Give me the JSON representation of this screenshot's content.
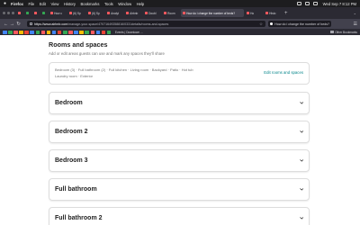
{
  "menubar": {
    "app": "Firefox",
    "items": [
      "File",
      "Edit",
      "View",
      "History",
      "Bookmarks",
      "Tools",
      "Window",
      "Help"
    ],
    "clock": "Wed Sep 7  8:12 PM"
  },
  "tabs": [
    {
      "label": "",
      "color": "#ff5a5f",
      "size": "narrow"
    },
    {
      "label": "",
      "color": "#34a853",
      "size": "narrow"
    },
    {
      "label": "",
      "color": "#ff5a5f",
      "size": "narrow"
    },
    {
      "label": "",
      "color": "#34a853",
      "size": "narrow"
    },
    {
      "label": "How c",
      "color": "#ff5a5f",
      "size": "wide"
    },
    {
      "label": "(6) Sp",
      "color": "#ff5a5f",
      "size": "wide"
    },
    {
      "label": "(6) Sp",
      "color": "#ff5a5f",
      "size": "wide"
    },
    {
      "label": "Analyt",
      "color": "#ff5a5f",
      "size": "wide"
    },
    {
      "label": "Airbnb",
      "color": "#ff5a5f",
      "size": "wide"
    },
    {
      "label": "Doubl",
      "color": "#ff5a5f",
      "size": "wide"
    },
    {
      "label": "Room",
      "color": "#ff5a5f",
      "size": "wide"
    },
    {
      "label": "How do i change the number of beds?",
      "color": "#ff5a5f",
      "size": "active"
    },
    {
      "label": "Ho",
      "color": "#ff5a5f",
      "size": "wide"
    },
    {
      "label": "Histo",
      "color": "#ff5a5f",
      "size": "wide"
    }
  ],
  "nav": {
    "url_domain": "https://www.airbnb.com",
    "url_path": "/manage-your-space/47071649358816/0331details/rooms-and-spaces",
    "search_tab": "How do i change the number of beds?"
  },
  "bookmarks": {
    "colors": [
      "#4285f4",
      "#34a853",
      "#ff5a5f",
      "#fbbc05",
      "#ea4335",
      "#4285f4",
      "#34a853",
      "#ff5a5f",
      "#fbbc05",
      "#4285f4",
      "#ea4335",
      "#34a853",
      "#ff5a5f",
      "#4285f4",
      "#fbbc05",
      "#34a853",
      "#ff5a5f",
      "#4285f4",
      "#ea4335",
      "#34a853"
    ],
    "label": "Events | Downtown ...",
    "other": "Other Bookmarks"
  },
  "page": {
    "heading": "Rooms and spaces",
    "subtext": "Add or edit areas guests can use and mark any spaces they'll share",
    "spaces_line1": "Bedroom (3) · Full bathroom (2) · Full kitchen · Living room · Backyard · Patio · Hot tub",
    "spaces_line2": "Laundry room · Exterior",
    "edit_link": "Edit rooms and spaces",
    "cards": [
      "Bedroom",
      "Bedroom 2",
      "Bedroom 3",
      "Full bathroom",
      "Full bathroom 2"
    ]
  }
}
